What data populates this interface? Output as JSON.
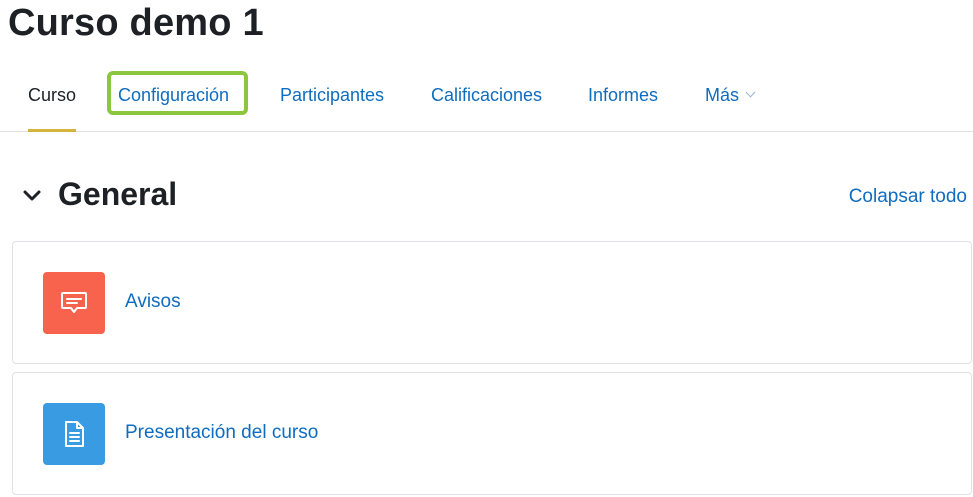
{
  "page": {
    "title": "Curso demo 1"
  },
  "nav": {
    "tabs": [
      {
        "label": "Curso",
        "active": true
      },
      {
        "label": "Configuración",
        "active": false,
        "highlighted": true
      },
      {
        "label": "Participantes",
        "active": false
      },
      {
        "label": "Calificaciones",
        "active": false
      },
      {
        "label": "Informes",
        "active": false
      },
      {
        "label": "Más",
        "active": false,
        "dropdown": true
      }
    ]
  },
  "section": {
    "title": "General",
    "collapse_all_label": "Colapsar todo",
    "activities": [
      {
        "label": "Avisos",
        "icon": "forum-icon",
        "icon_color": "#f7634d"
      },
      {
        "label": "Presentación del curso",
        "icon": "file-icon",
        "icon_color": "#399be2"
      }
    ]
  },
  "colors": {
    "link": "#0f6cbf",
    "text": "#1d2125",
    "active_tab_underline": "#d6b33d",
    "highlight_border": "#8cc63f"
  }
}
